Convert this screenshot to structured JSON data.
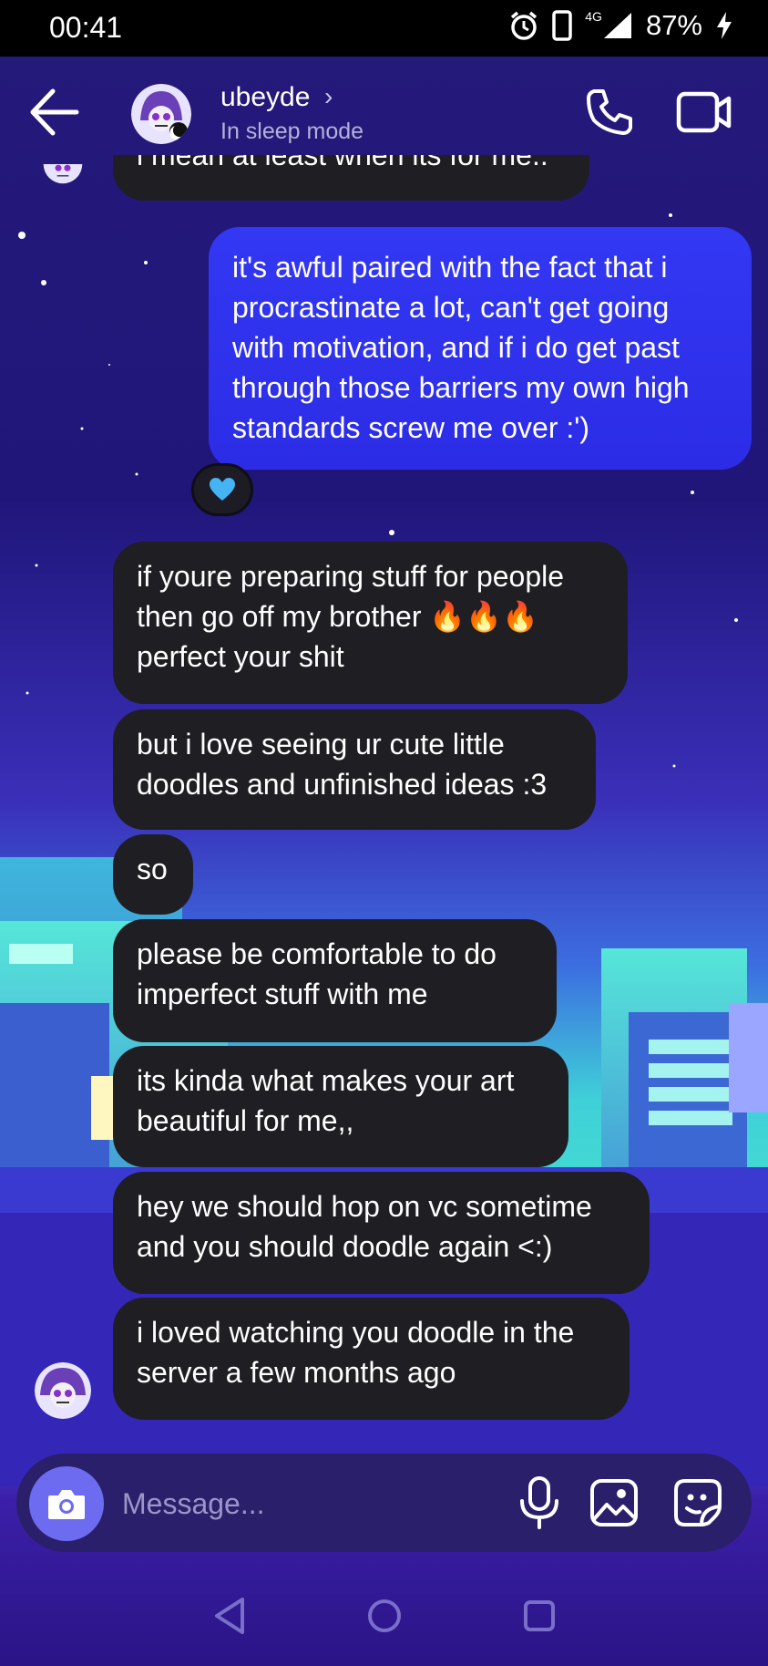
{
  "status_bar": {
    "time": "00:41",
    "network": "4G",
    "battery": "87%"
  },
  "header": {
    "contact_name": "ubeyde",
    "contact_status": "In sleep mode"
  },
  "messages": {
    "clipped_top": "i mean at least when its for me..",
    "outgoing_1": "it's awful paired with the fact that i\nprocrastinate a lot, can't get going\nwith motivation, and if i do get past\nthrough those barriers my own high\nstandards screw me over :')",
    "reaction": "💙",
    "in_1": "if youre preparing stuff for people\nthen go off my brother 🔥🔥🔥\nperfect your shit",
    "in_2": "but i love seeing ur cute little\ndoodles and unfinished ideas :3",
    "in_3": "so",
    "in_4": "please be comfortable to do\nimperfect stuff with me",
    "in_5": "its kinda what makes your art\nbeautiful for me,,",
    "in_6": "hey we should hop on vc sometime\nand you should doodle again <:)",
    "in_7": "i loved watching you doodle in the\nserver a few months ago"
  },
  "composer": {
    "placeholder": "Message..."
  },
  "icons": {
    "back": "arrow-left-icon",
    "call": "phone-icon",
    "video": "video-camera-icon",
    "camera": "camera-icon",
    "mic": "microphone-icon",
    "gallery": "image-icon",
    "sticker": "sticker-icon",
    "nav_back": "triangle-back-icon",
    "nav_home": "circle-home-icon",
    "nav_recent": "square-recents-icon"
  },
  "colors": {
    "outgoing_bubble": "#3035f0",
    "incoming_bubble": "#1f1e22",
    "camera_button": "#6d6cf0",
    "composer": "#2a1f6b"
  }
}
